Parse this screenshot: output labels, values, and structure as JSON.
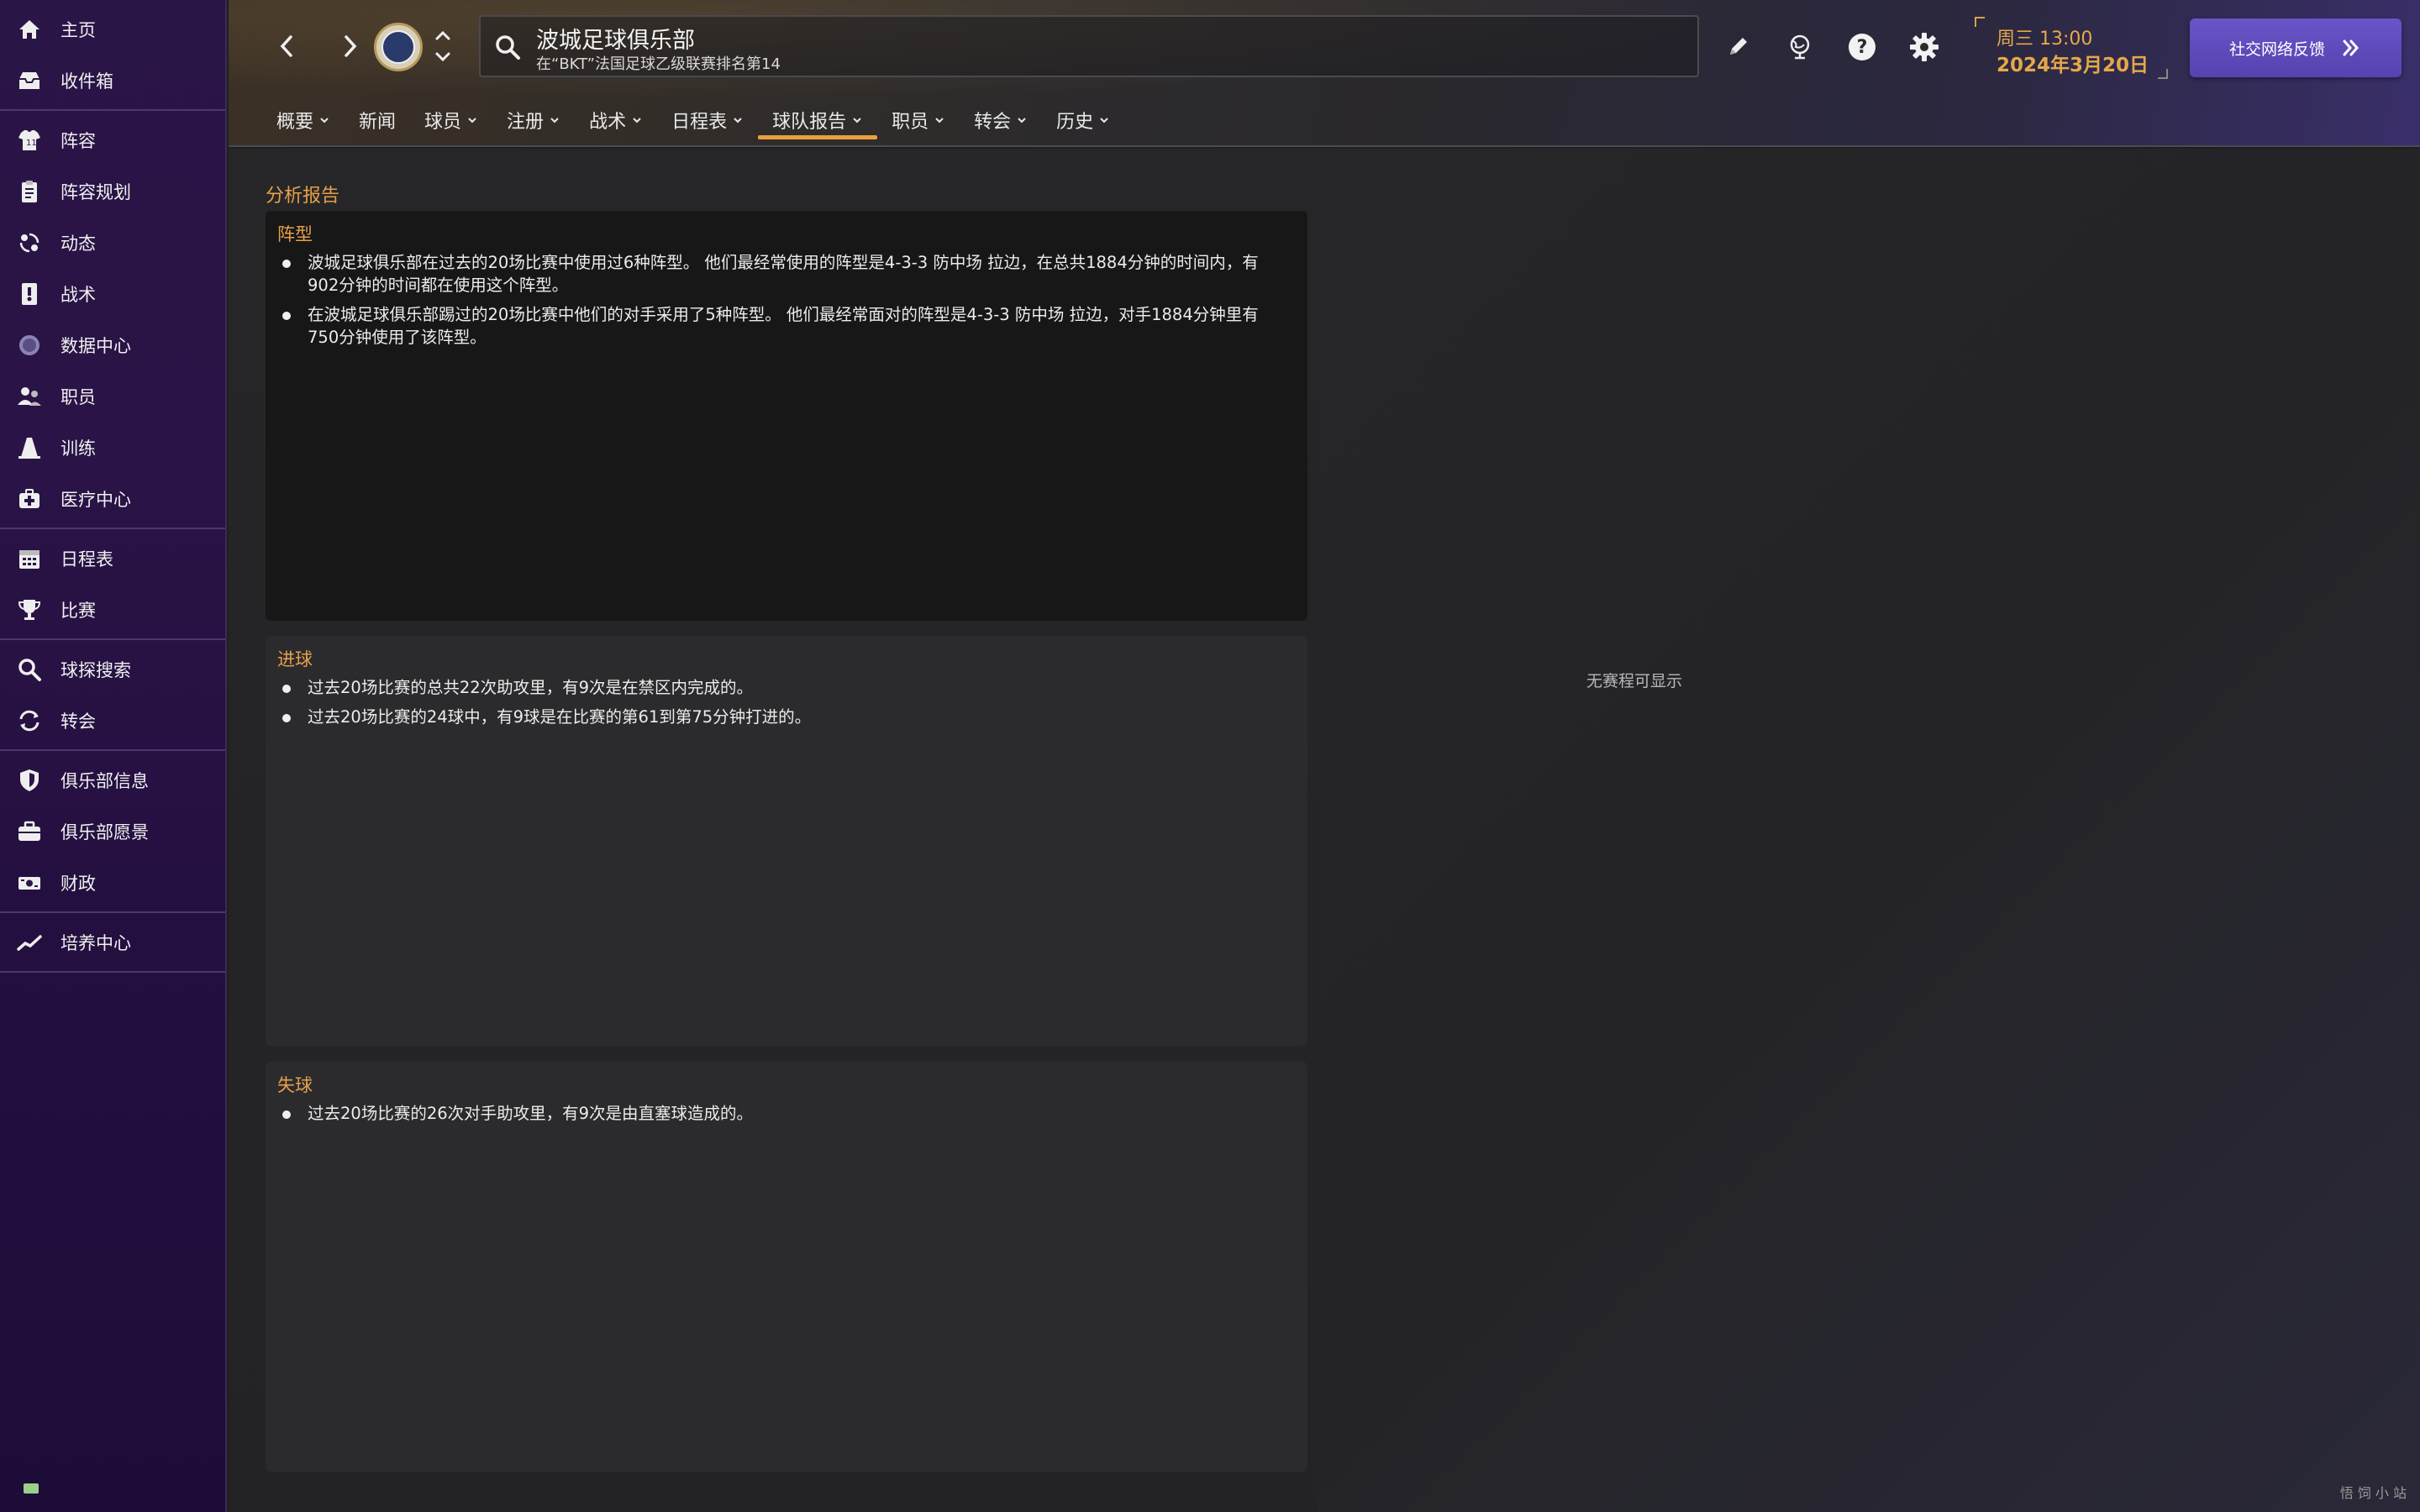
{
  "sidebar": {
    "groups": [
      [
        {
          "label": "主页",
          "icon": "home-icon"
        },
        {
          "label": "收件箱",
          "icon": "inbox-icon"
        }
      ],
      [
        {
          "label": "阵容",
          "icon": "shirt-icon"
        },
        {
          "label": "阵容规划",
          "icon": "clipboard-icon"
        },
        {
          "label": "动态",
          "icon": "dynamics-icon"
        },
        {
          "label": "战术",
          "icon": "tactics-icon"
        },
        {
          "label": "数据中心",
          "icon": "data-hub-icon"
        },
        {
          "label": "职员",
          "icon": "staff-icon"
        },
        {
          "label": "训练",
          "icon": "training-cone-icon"
        },
        {
          "label": "医疗中心",
          "icon": "medical-kit-icon"
        }
      ],
      [
        {
          "label": "日程表",
          "icon": "calendar-icon"
        },
        {
          "label": "比赛",
          "icon": "trophy-icon"
        }
      ],
      [
        {
          "label": "球探搜索",
          "icon": "search-icon"
        },
        {
          "label": "转会",
          "icon": "transfer-icon"
        }
      ],
      [
        {
          "label": "俱乐部信息",
          "icon": "shield-icon"
        },
        {
          "label": "俱乐部愿景",
          "icon": "briefcase-icon"
        },
        {
          "label": "财政",
          "icon": "money-icon"
        }
      ],
      [
        {
          "label": "培养中心",
          "icon": "development-icon"
        }
      ]
    ]
  },
  "header": {
    "club_title": "波城足球俱乐部",
    "club_subtitle": "在“BKT”法国足球乙级联赛排名第14",
    "date_day": "周三 13:00",
    "date_full": "2024年3月20日",
    "feedback_label": "社交网络反馈",
    "tabs": [
      {
        "label": "概要",
        "dropdown": true
      },
      {
        "label": "新闻",
        "dropdown": false
      },
      {
        "label": "球员",
        "dropdown": true
      },
      {
        "label": "注册",
        "dropdown": true
      },
      {
        "label": "战术",
        "dropdown": true
      },
      {
        "label": "日程表",
        "dropdown": true
      },
      {
        "label": "球队报告",
        "dropdown": true,
        "active": true
      },
      {
        "label": "职员",
        "dropdown": true
      },
      {
        "label": "转会",
        "dropdown": true
      },
      {
        "label": "历史",
        "dropdown": true
      }
    ]
  },
  "main": {
    "section_title": "分析报告",
    "panels": [
      {
        "title": "阵型",
        "items": [
          "波城足球俱乐部在过去的20场比赛中使用过6种阵型。 他们最经常使用的阵型是4-3-3 防中场 拉边，在总共1884分钟的时间内，有902分钟的时间都在使用这个阵型。",
          "在波城足球俱乐部踢过的20场比赛中他们的对手采用了5种阵型。 他们最经常面对的阵型是4-3-3 防中场 拉边，对手1884分钟里有750分钟使用了该阵型。"
        ]
      },
      {
        "title": "进球",
        "items": [
          "过去20场比赛的总共22次助攻里，有9次是在禁区内完成的。",
          "过去20场比赛的24球中，有9球是在比赛的第61到第75分钟打进的。"
        ]
      },
      {
        "title": "失球",
        "items": [
          "过去20场比赛的26次对手助攻里，有9次是由直塞球造成的。"
        ]
      }
    ],
    "right_empty_text": "无赛程可显示"
  },
  "watermark": "悟 饲 小 站"
}
